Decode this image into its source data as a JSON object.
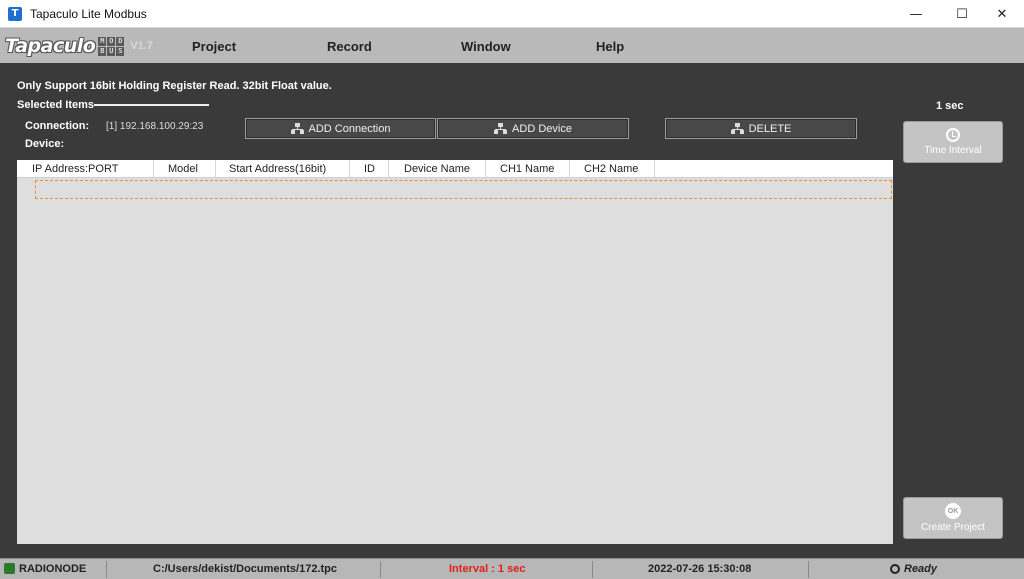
{
  "window": {
    "title": "Tapaculo Lite Modbus",
    "app_icon_letter": "T",
    "minimize": "—",
    "maximize": "☐",
    "close": "✕"
  },
  "logo": {
    "word": "Tapaculo",
    "sub_letters": [
      "M",
      "O",
      "D",
      "B",
      "U",
      "S"
    ],
    "version": "V1.7"
  },
  "menu": {
    "items": [
      "Project",
      "Record",
      "Window",
      "Help"
    ]
  },
  "panel": {
    "notice": "Only Support 16bit Holding Register Read. 32bit Float value.",
    "selected_items_label": "Selected Items",
    "connection_label": "Connection:",
    "connection_value": "[1] 192.168.100.29:23",
    "device_label": "Device:"
  },
  "toolbar": {
    "add_connection": "ADD Connection",
    "add_device": "ADD Device",
    "delete": "DELETE"
  },
  "table": {
    "columns": [
      "IP Address:PORT",
      "Model",
      "Start Address(16bit)",
      "ID",
      "Device Name",
      "CH1 Name",
      "CH2 Name"
    ]
  },
  "side": {
    "interval_value": "1 sec",
    "time_interval_label": "Time Interval",
    "ok_icon_text": "OK",
    "create_project_label": "Create Project"
  },
  "status": {
    "brand": "RADIONODE",
    "file_path": "C:/Users/dekist/Documents/172.tpc",
    "interval": "Interval : 1 sec",
    "datetime": "2022-07-26 15:30:08",
    "state": "Ready",
    "interval_color": "#e0201a"
  }
}
